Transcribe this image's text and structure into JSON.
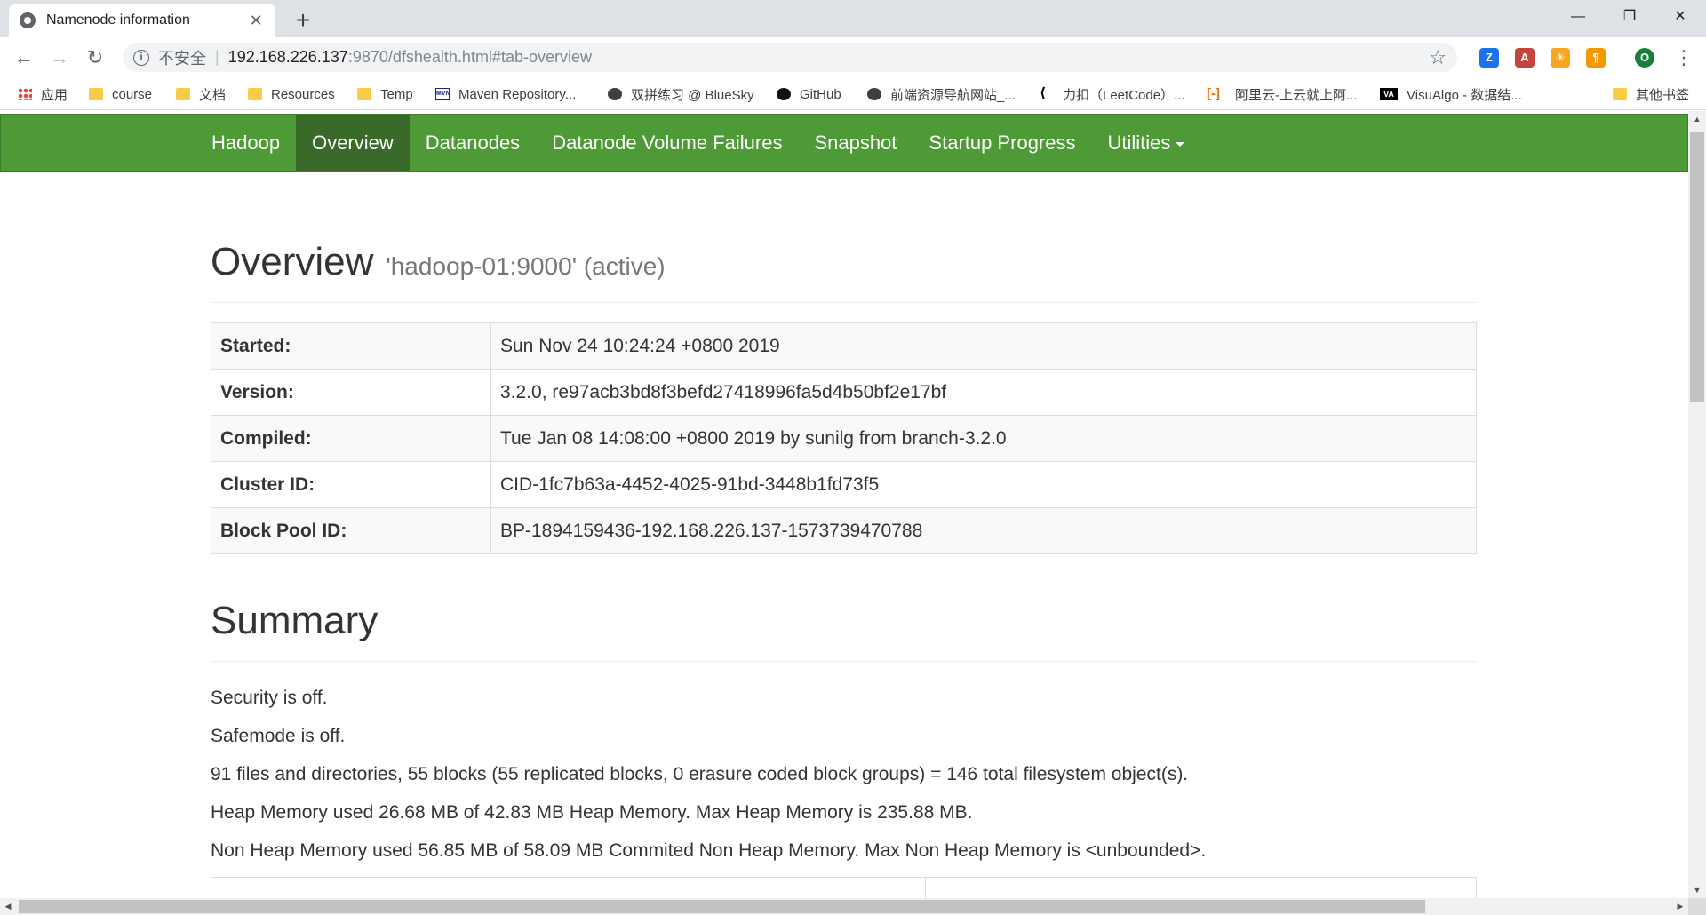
{
  "browser": {
    "tab_title": "Namenode information",
    "tab_close": "✕",
    "new_tab": "+",
    "window_controls": {
      "minimize": "—",
      "restore": "❐",
      "close": "✕"
    },
    "nav": {
      "back": "←",
      "forward": "→",
      "reload": "↻"
    },
    "url": {
      "info": "i",
      "insecure_label": "不安全",
      "separator": "|",
      "host": "192.168.226.137",
      "path": ":9870/dfshealth.html#tab-overview",
      "star": "☆"
    },
    "extensions": [
      {
        "icon": "z-extension-icon",
        "glyph": "Z",
        "color": "#1a73e8"
      },
      {
        "icon": "pdf-extension-icon",
        "glyph": "A",
        "color": "#c4453b"
      },
      {
        "icon": "sun-extension-icon",
        "glyph": "☀",
        "color": "#f6a623"
      },
      {
        "icon": "paragraph-extension-icon",
        "glyph": "¶",
        "color": "#f29900"
      },
      {
        "icon": "profile-avatar-icon",
        "glyph": "O",
        "color": "#188038"
      }
    ],
    "menu": "⋮",
    "bookmarks": [
      {
        "label": "应用",
        "icon": "apps-grid-icon"
      },
      {
        "label": "course",
        "icon": "folder-icon"
      },
      {
        "label": "文档",
        "icon": "folder-icon"
      },
      {
        "label": "Resources",
        "icon": "folder-icon"
      },
      {
        "label": "Temp",
        "icon": "folder-icon"
      },
      {
        "label": "Maven Repository...",
        "icon": "mvn-icon",
        "glyph": "MVN"
      },
      {
        "label": "双拼练习 @ BlueSky",
        "icon": "globe-icon"
      },
      {
        "label": "GitHub",
        "icon": "github-icon"
      },
      {
        "label": "前端资源导航网站_...",
        "icon": "globe-icon"
      },
      {
        "label": "力扣（LeetCode）...",
        "icon": "leetcode-icon",
        "glyph": "⟨"
      },
      {
        "label": "阿里云-上云就上阿...",
        "icon": "aliyun-icon",
        "glyph": "[-]"
      },
      {
        "label": "VisuAlgo - 数据结...",
        "icon": "visualgo-icon",
        "glyph": "VA"
      }
    ],
    "other_bookmarks": "其他书签"
  },
  "navbar": {
    "brand": "Hadoop",
    "items": [
      {
        "label": "Overview",
        "active": true
      },
      {
        "label": "Datanodes",
        "active": false
      },
      {
        "label": "Datanode Volume Failures",
        "active": false
      },
      {
        "label": "Snapshot",
        "active": false
      },
      {
        "label": "Startup Progress",
        "active": false
      }
    ],
    "utilities": "Utilities"
  },
  "overview": {
    "title": "Overview",
    "subtitle": "'hadoop-01:9000' (active)",
    "rows": [
      {
        "key": "Started:",
        "value": "Sun Nov 24 10:24:24 +0800 2019"
      },
      {
        "key": "Version:",
        "value": "3.2.0, re97acb3bd8f3befd27418996fa5d4b50bf2e17bf"
      },
      {
        "key": "Compiled:",
        "value": "Tue Jan 08 14:08:00 +0800 2019 by sunilg from branch-3.2.0"
      },
      {
        "key": "Cluster ID:",
        "value": "CID-1fc7b63a-4452-4025-91bd-3448b1fd73f5"
      },
      {
        "key": "Block Pool ID:",
        "value": "BP-1894159436-192.168.226.137-1573739470788"
      }
    ]
  },
  "summary": {
    "title": "Summary",
    "lines": [
      "Security is off.",
      "Safemode is off.",
      "91 files and directories, 55 blocks (55 replicated blocks, 0 erasure coded block groups) = 146 total filesystem object(s).",
      "Heap Memory used 26.68 MB of 42.83 MB Heap Memory. Max Heap Memory is 235.88 MB.",
      "Non Heap Memory used 56.85 MB of 58.09 MB Commited Non Heap Memory. Max Non Heap Memory is <unbounded>."
    ]
  },
  "scrollbars": {
    "up": "▲",
    "down": "▼",
    "left": "◀",
    "right": "▶"
  }
}
